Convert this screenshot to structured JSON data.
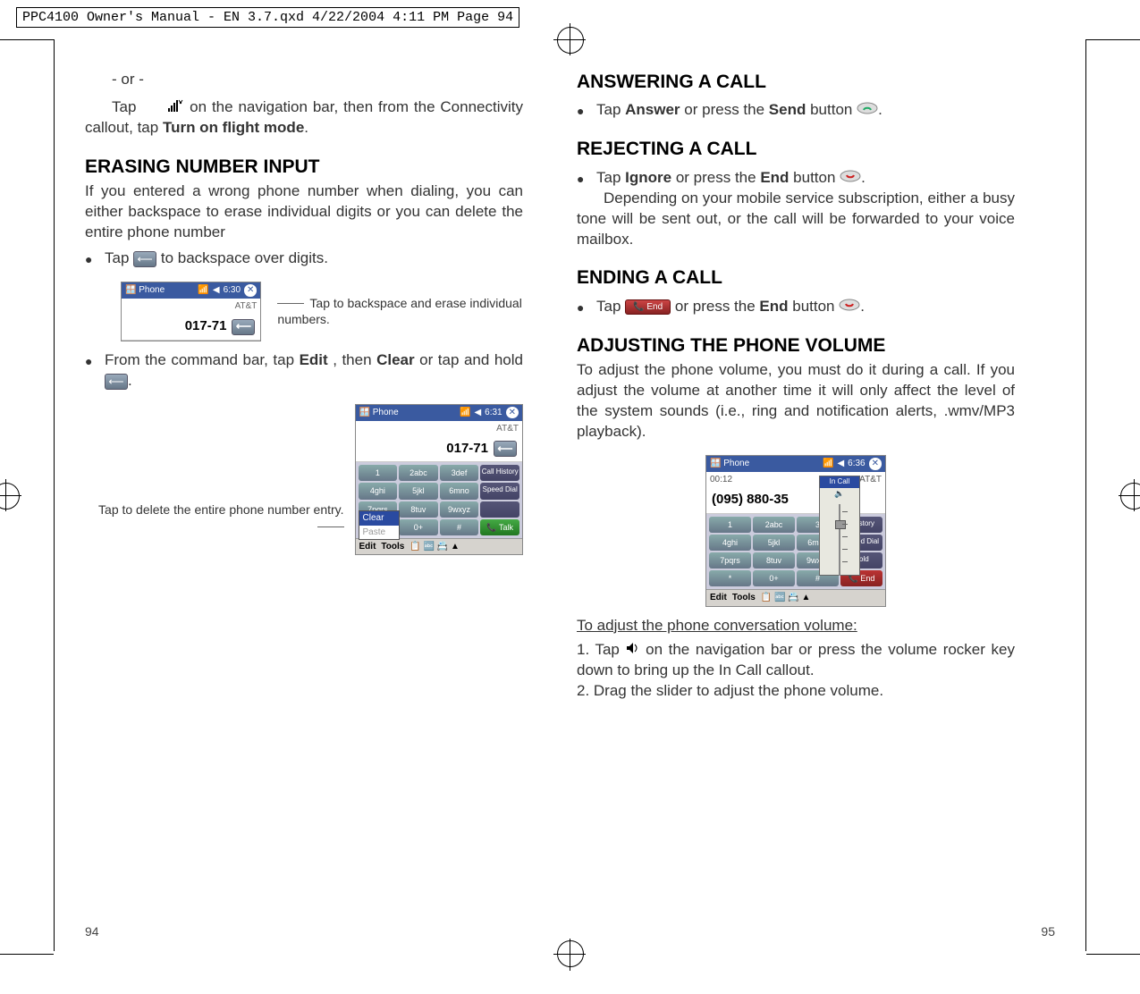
{
  "header_line": "PPC4100 Owner's Manual - EN 3.7.qxd  4/22/2004  4:11 PM  Page 94",
  "left": {
    "or_text": "- or -",
    "tap_nav_line_a": "Tap ",
    "tap_nav_line_b": " on the navigation bar, then from the Connectivity callout, tap ",
    "flight_mode_bold": "Turn on flight mode",
    "period": ".",
    "h_erasing": "ERASING NUMBER INPUT",
    "erasing_body": "If you entered a wrong phone number when dialing, you can either backspace to erase individual digits or you can delete the entire phone number",
    "bullet_tap": "Tap ",
    "bullet_backspace": " to backspace over digits.",
    "fig1_caption": "Tap to backspace and erase individual numbers.",
    "bullet2_a": "From the command bar, tap ",
    "bullet2_edit": "Edit",
    "bullet2_b": ", then ",
    "bullet2_clear": "Clear",
    "bullet2_c": " or tap and hold ",
    "fig2_caption": "Tap to delete the entire phone number entry.",
    "page_num": "94"
  },
  "right": {
    "h_answer": "ANSWERING A CALL",
    "ans_a": "Tap ",
    "ans_answer": "Answer",
    "ans_b": " or press the ",
    "ans_send": "Send",
    "ans_c": " button ",
    "h_reject": "REJECTING A CALL",
    "rej_a": "Tap ",
    "rej_ignore": "Ignore",
    "rej_b": " or press the ",
    "rej_end": "End",
    "rej_c": " button ",
    "rej_body": "Depending on your mobile service subscription, either a busy tone will be sent out, or the call will be forwarded to your voice mailbox.",
    "h_ending": "ENDING A CALL",
    "end_a": "Tap ",
    "end_b": " or press the ",
    "end_end": "End",
    "end_c": " button ",
    "h_adjust": "ADJUSTING THE PHONE VOLUME",
    "adjust_body": "To adjust the phone  volume, you must do it during a call. If you adjust the volume at another time it will only affect the level of the system sounds (i.e., ring and notification alerts, .wmv/MP3 playback).",
    "adjust_sub": "To adjust the phone conversation volume:",
    "step1_a": "1. Tap ",
    "step1_b": " on the navigation bar or press the volume rocker key down to bring up the In Call callout.",
    "step2": "2. Drag the slider to adjust the phone volume.",
    "page_num": "95"
  },
  "ss1": {
    "title": "Phone",
    "time": "6:30",
    "carrier": "AT&T",
    "number": "017-71"
  },
  "ss2": {
    "title": "Phone",
    "time": "6:31",
    "carrier": "AT&T",
    "number": "017-71",
    "clear": "Clear",
    "paste": "Paste",
    "edit": "Edit",
    "tools": "Tools",
    "talk": "Talk",
    "callhist": "Call History",
    "speeddial": "Speed Dial"
  },
  "ss3": {
    "title": "Phone",
    "time": "6:36",
    "carrier": "AT&T",
    "duration": "00:12",
    "number": "(095) 880-35",
    "incall": "In Call",
    "edit": "Edit",
    "tools": "Tools",
    "hold": "Hold",
    "end": "End",
    "lhistory": "l History",
    "speeddial": "Speed Dial"
  },
  "keypad": {
    "k1": "1",
    "k2": "2abc",
    "k3": "3def",
    "k4": "4ghi",
    "k5": "5jkl",
    "k6": "6mno",
    "k7": "7pqrs",
    "k8": "8tuv",
    "k9": "9wxyz",
    "kstar": "*",
    "k0": "0+",
    "khash": "#"
  }
}
